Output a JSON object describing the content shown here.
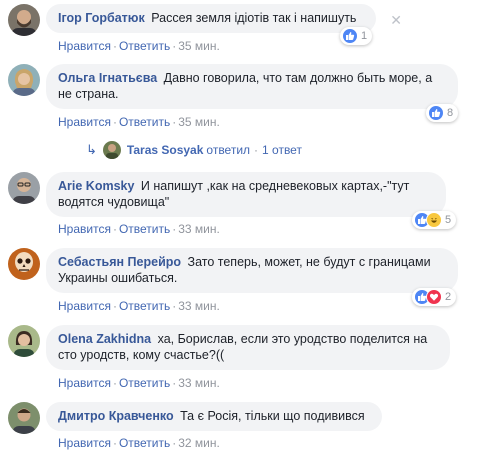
{
  "comments": [
    {
      "author": "Ігор Горбатюк",
      "text": "Рассея земля ідіотів так і напишуть",
      "actions": {
        "like": "Нравится",
        "reply": "Ответить",
        "time": "35 мин."
      },
      "reactions": {
        "count": "1",
        "icons": [
          "like-icon"
        ]
      },
      "avatar": "bearded-man-avatar"
    },
    {
      "author": "Ольга Ігнатьєва",
      "text": "Давно говорила, что там должно быть море, а не страна.",
      "actions": {
        "like": "Нравится",
        "reply": "Ответить",
        "time": "35 мин."
      },
      "reactions": {
        "count": "8",
        "icons": [
          "like-icon"
        ]
      },
      "avatar": "woman-avatar",
      "replies": {
        "author": "Taras Sosyak",
        "verb": "ответил",
        "count": "1 ответ"
      }
    },
    {
      "author": "Arie Komsky",
      "text": "И напишут ,как на средневековых картах,-\"тут водятся чудовища\"",
      "actions": {
        "like": "Нравится",
        "reply": "Ответить",
        "time": "33 мин."
      },
      "reactions": {
        "count": "5",
        "icons": [
          "like-icon",
          "haha-icon"
        ]
      },
      "avatar": "man-with-glasses-avatar"
    },
    {
      "author": "Себастьян Перейро",
      "text": "Зато теперь, может, не будут с границами Украины ошибаться.",
      "actions": {
        "like": "Нравится",
        "reply": "Ответить",
        "time": "33 мин."
      },
      "reactions": {
        "count": "2",
        "icons": [
          "like-icon",
          "love-icon"
        ]
      },
      "avatar": "skull-avatar"
    },
    {
      "author": "Olena Zakhidna",
      "text": "ха, Борислав, если это уродство поделится на сто уродств, кому счастье?((",
      "actions": {
        "like": "Нравится",
        "reply": "Ответить",
        "time": "33 мин."
      },
      "avatar": "woman-outdoor-avatar"
    },
    {
      "author": "Дмитро Кравченко",
      "text": "Та є Росія, тільки що подивився",
      "actions": {
        "like": "Нравится",
        "reply": "Ответить",
        "time": "32 мин."
      },
      "avatar": "man-outdoor-avatar"
    }
  ],
  "colors": {
    "link": "#385898",
    "bubble": "#f2f3f5",
    "like": "#4e86f5",
    "love": "#f0344f",
    "haha": "#f8c83f",
    "meta": "#90949c"
  }
}
